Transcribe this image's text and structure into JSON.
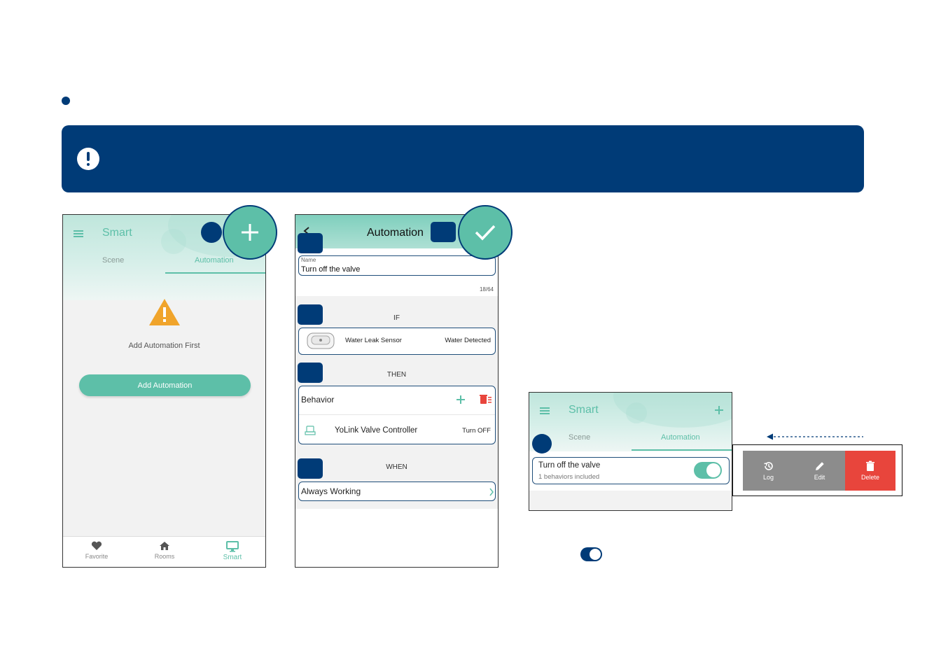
{
  "colors": {
    "navy": "#003b77",
    "teal": "#5dbfa8",
    "warning": "#f0a42b",
    "delete_red": "#e8453c",
    "action_gray": "#8c8c8c"
  },
  "screen1": {
    "title": "Smart",
    "tabs": [
      "Scene",
      "Automation"
    ],
    "empty_text": "Add Automation First",
    "add_button": "Add Automation",
    "tabbar": [
      "Favorite",
      "Rooms",
      "Smart"
    ]
  },
  "screen2": {
    "title": "Automation",
    "name_label": "Name",
    "name_value": "Turn off the valve",
    "char_count": "18/64",
    "if_label": "IF",
    "if_device": "Water Leak Sensor",
    "if_state": "Water Detected",
    "then_label": "THEN",
    "behavior_label": "Behavior",
    "then_device": "YoLink Valve Controller",
    "then_action": "Turn OFF",
    "when_label": "WHEN",
    "when_value": "Always Working"
  },
  "screen3": {
    "title": "Smart",
    "tabs": [
      "Scene",
      "Automation"
    ],
    "item_title": "Turn off the valve",
    "item_sub": "1 behaviors included",
    "actions": {
      "log": "Log",
      "edit": "Edit",
      "delete": "Delete"
    }
  },
  "icons": [
    "exclamation-icon",
    "menu-icon",
    "plus-icon",
    "check-icon",
    "warning-icon",
    "back-icon",
    "sensor-icon",
    "valve-icon",
    "trash-icon",
    "chevron-right-icon",
    "heart-icon",
    "home-icon",
    "monitor-icon",
    "history-icon",
    "pencil-icon",
    "toggle-icon",
    "arrow-left-icon"
  ]
}
